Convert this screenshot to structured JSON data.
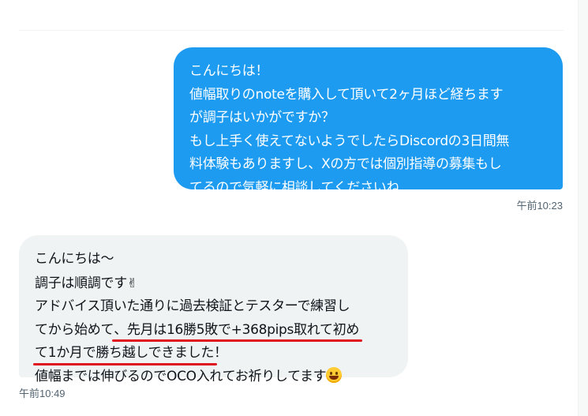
{
  "sent_message": {
    "lines": [
      "こんにちは！",
      "値幅取りのnoteを購入して頂いて2ヶ月ほど経ちます",
      "が調子はいかがですか？",
      "もし上手く使えてないようでしたらDiscordの3日間無",
      "料体験もありますし、Xの方では個別指導の募集もし",
      "てるので気軽に相談してくださいね"
    ],
    "timestamp": "午前10:23"
  },
  "received_message": {
    "line1": "こんにちは～",
    "line2": "調子は順調です",
    "line2_emoji": "✌",
    "line3": "アドバイス頂いた通りに過去検証とテスターで練習し",
    "line4_pre": "てから始めて",
    "line4_ul": "、先月は16勝5敗で+368pips取れて初め",
    "line5_ul": "て1か月で勝ち越しできました",
    "line5_post": "！",
    "line6": "値幅までは伸びるのでOCO入れてお祈りしてます",
    "line6_emoji_name": "grinning-face-icon",
    "timestamp": "午前10:49"
  },
  "colors": {
    "sent_bubble": "#1d9bf0",
    "received_bubble": "#eff3f4",
    "underline": "#e0141e"
  }
}
